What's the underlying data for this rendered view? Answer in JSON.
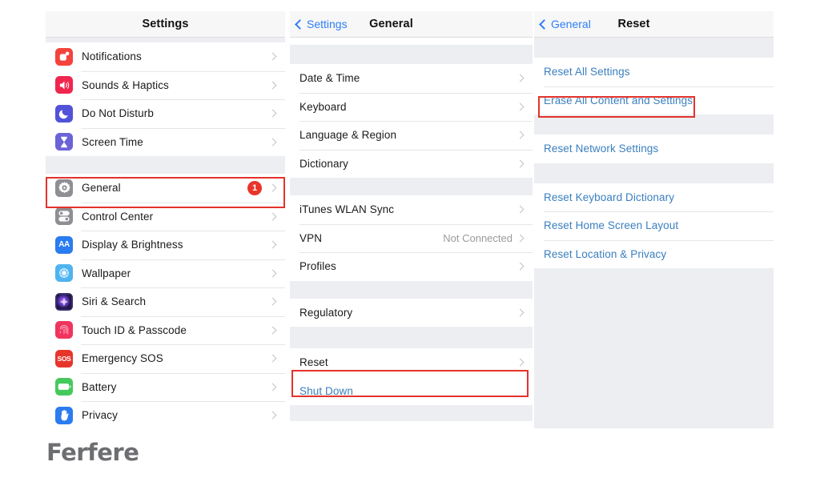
{
  "brand": {
    "logo_text": "Ferfere",
    "highlight_color": "#e4322b",
    "link_color": "#3a7fbf",
    "tint_color": "#2d7ff9"
  },
  "panels": {
    "settings": {
      "nav": {
        "title": "Settings"
      },
      "rows": [
        {
          "label": "Notifications",
          "icon": "notifications-icon",
          "color": "#f4433c"
        },
        {
          "label": "Sounds & Haptics",
          "icon": "speaker-icon",
          "color": "#f0264f"
        },
        {
          "label": "Do Not Disturb",
          "icon": "moon-icon",
          "color": "#5252d8"
        },
        {
          "label": "Screen Time",
          "icon": "hourglass-icon",
          "color": "#6b63d6"
        }
      ],
      "rows2": [
        {
          "label": "General",
          "icon": "gear-icon",
          "color": "#8e8e93",
          "badge": "1"
        },
        {
          "label": "Control Center",
          "icon": "sliders-icon",
          "color": "#8e8e93"
        },
        {
          "label": "Display & Brightness",
          "icon": "aa-icon",
          "color": "#2a7cf0"
        },
        {
          "label": "Wallpaper",
          "icon": "wallpaper-icon",
          "color": "#4fb3ef"
        },
        {
          "label": "Siri & Search",
          "icon": "siri-icon",
          "color": "#3b2f6b"
        },
        {
          "label": "Touch ID & Passcode",
          "icon": "fingerprint-icon",
          "color": "#f0345f"
        },
        {
          "label": "Emergency SOS",
          "icon": "sos-icon",
          "color": "#e8352b"
        },
        {
          "label": "Battery",
          "icon": "battery-icon",
          "color": "#45c95d"
        },
        {
          "label": "Privacy",
          "icon": "hand-icon",
          "color": "#2a7cf0"
        }
      ]
    },
    "general": {
      "nav": {
        "back_label": "Settings",
        "title": "General"
      },
      "group_a": [
        {
          "label": "Date & Time"
        },
        {
          "label": "Keyboard"
        },
        {
          "label": "Language & Region"
        },
        {
          "label": "Dictionary"
        }
      ],
      "group_b": [
        {
          "label": "iTunes WLAN Sync"
        },
        {
          "label": "VPN",
          "value": "Not Connected"
        },
        {
          "label": "Profiles"
        }
      ],
      "group_c": [
        {
          "label": "Regulatory"
        }
      ],
      "group_d": [
        {
          "label": "Reset"
        }
      ],
      "group_e": [
        {
          "label": "Shut Down"
        }
      ]
    },
    "reset": {
      "nav": {
        "back_label": "General",
        "title": "Reset"
      },
      "group_a": [
        {
          "label": "Reset All Settings"
        },
        {
          "label": "Erase All Content and Settings"
        }
      ],
      "group_b": [
        {
          "label": "Reset Network Settings"
        }
      ],
      "group_c": [
        {
          "label": "Reset Keyboard Dictionary"
        },
        {
          "label": "Reset Home Screen Layout"
        },
        {
          "label": "Reset Location & Privacy"
        }
      ]
    }
  }
}
